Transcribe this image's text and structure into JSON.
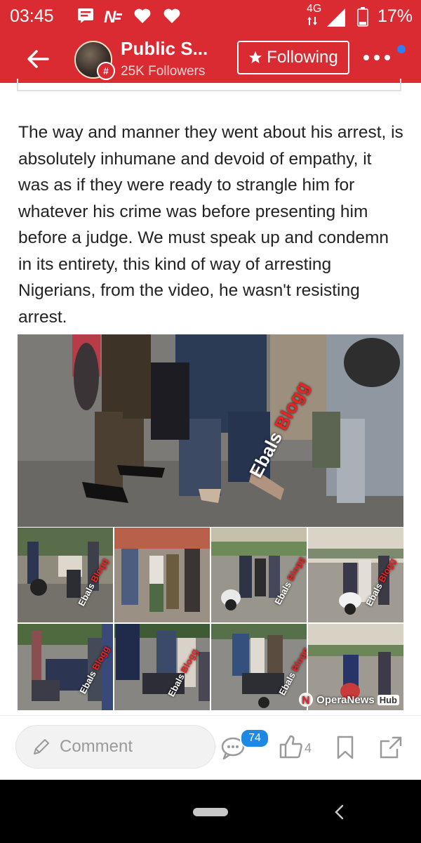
{
  "status_bar": {
    "time": "03:45",
    "network": "4G",
    "battery": "17%",
    "icons": [
      "message-icon",
      "news-n-icon",
      "heart-icon",
      "heart-icon",
      "signal-icon",
      "battery-icon"
    ]
  },
  "header": {
    "publisher_name": "Public S...",
    "followers": "25K Followers",
    "follow_button": "Following",
    "avatar_badge": "#",
    "accent_color": "#d92b31",
    "notification_dot_color": "#2f7ff0"
  },
  "article": {
    "body": "The way and manner they went about his arrest, is absolutely inhumane and devoid of empathy, it was as if they were ready to strangle him for whatever his crime was before presenting him before a judge. We must speak up and condemn in its entirety, this kind of way of arresting Nigerians, from the video, he wasn't resisting arrest.",
    "image_watermark_a": "Ebals ",
    "image_watermark_b": "Blogg",
    "source_logo": "OperaNews",
    "source_logo_hub": "Hub"
  },
  "actions": {
    "comment_placeholder": "Comment",
    "comment_count": "74",
    "like_count": "4"
  }
}
